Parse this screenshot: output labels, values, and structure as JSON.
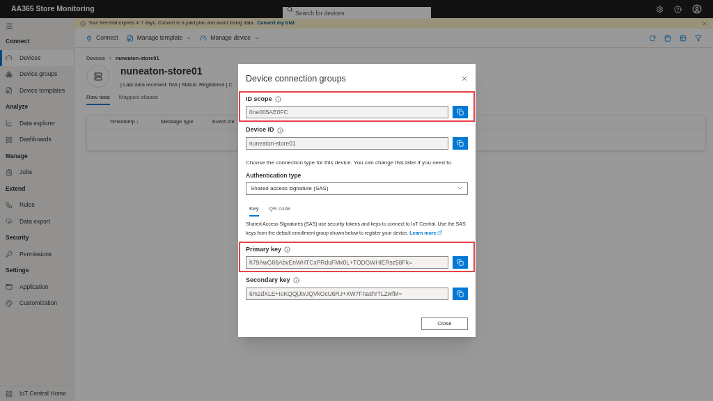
{
  "app_title": "AA365 Store Monitoring",
  "search": {
    "placeholder": "Search for devices"
  },
  "sidebar": {
    "items": [
      {
        "kind": "heading",
        "label": "Connect"
      },
      {
        "kind": "item",
        "label": "Devices",
        "selected": true
      },
      {
        "kind": "item",
        "label": "Device groups",
        "selected": false
      },
      {
        "kind": "item",
        "label": "Device templates",
        "selected": false
      },
      {
        "kind": "heading",
        "label": "Analyze"
      },
      {
        "kind": "item",
        "label": "Data explorer",
        "selected": false
      },
      {
        "kind": "item",
        "label": "Dashboards",
        "selected": false
      },
      {
        "kind": "heading",
        "label": "Manage"
      },
      {
        "kind": "item",
        "label": "Jobs",
        "selected": false
      },
      {
        "kind": "heading",
        "label": "Extend"
      },
      {
        "kind": "item",
        "label": "Rules",
        "selected": false
      },
      {
        "kind": "item",
        "label": "Data export",
        "selected": false
      },
      {
        "kind": "heading",
        "label": "Security"
      },
      {
        "kind": "item",
        "label": "Permissions",
        "selected": false
      },
      {
        "kind": "heading",
        "label": "Settings"
      },
      {
        "kind": "item",
        "label": "Application",
        "selected": false
      },
      {
        "kind": "item",
        "label": "Customization",
        "selected": false
      }
    ],
    "footer": "IoT Central Home"
  },
  "banner": {
    "text": "Your free trial expires in 7 days. Convert to a paid plan and avoid losing data.",
    "link": "Convert my trial"
  },
  "toolbar": [
    {
      "label": "Connect",
      "menu": false
    },
    {
      "label": "Manage template",
      "menu": true
    },
    {
      "label": "Manage device",
      "menu": true
    }
  ],
  "breadcrumb": [
    "Devices",
    "nuneaton-store01"
  ],
  "device": {
    "name": "nuneaton-store01",
    "status": "| Last data received: N/A | Status: Registered | C"
  },
  "tabs": [
    {
      "label": "Raw data",
      "selected": true
    },
    {
      "label": "Mapped aliases",
      "selected": false
    }
  ],
  "table": {
    "columns": [
      "Timestamp ↓",
      "Message type",
      "Event cre"
    ]
  },
  "dialog": {
    "title": "Device connection groups",
    "fields_top": [
      {
        "label": "ID scope",
        "value": "0ne005AE0FC",
        "highlighted": true
      },
      {
        "label": "Device ID",
        "value": "nuneaton-store01",
        "highlighted": false
      }
    ],
    "hint": "Choose the connection type for this device. You can change this later if you need to.",
    "auth_label": "Authentication type",
    "auth_value": "Shared access signature (SAS)",
    "tabs": [
      {
        "label": "Key",
        "selected": true
      },
      {
        "label": "QR code",
        "selected": false
      }
    ],
    "description": "Shared Access Signatures (SAS) use security tokens and keys to connect to IoT Central. Use the SAS keys from the default enrollment group shown below to register your device.",
    "learn_more": "Learn more",
    "fields_keys": [
      {
        "label": "Primary key",
        "value": "h79AwG86AbvEnWHTCxPRduFMx0L+TODGWHIERsz58Fk=",
        "highlighted": true
      },
      {
        "label": "Secondary key",
        "value": "6m2dXLE+IeKQQjJtvJQVkOcU6RJ+XW7FnashrTLZwfM=",
        "highlighted": false
      }
    ],
    "close": "Close"
  }
}
